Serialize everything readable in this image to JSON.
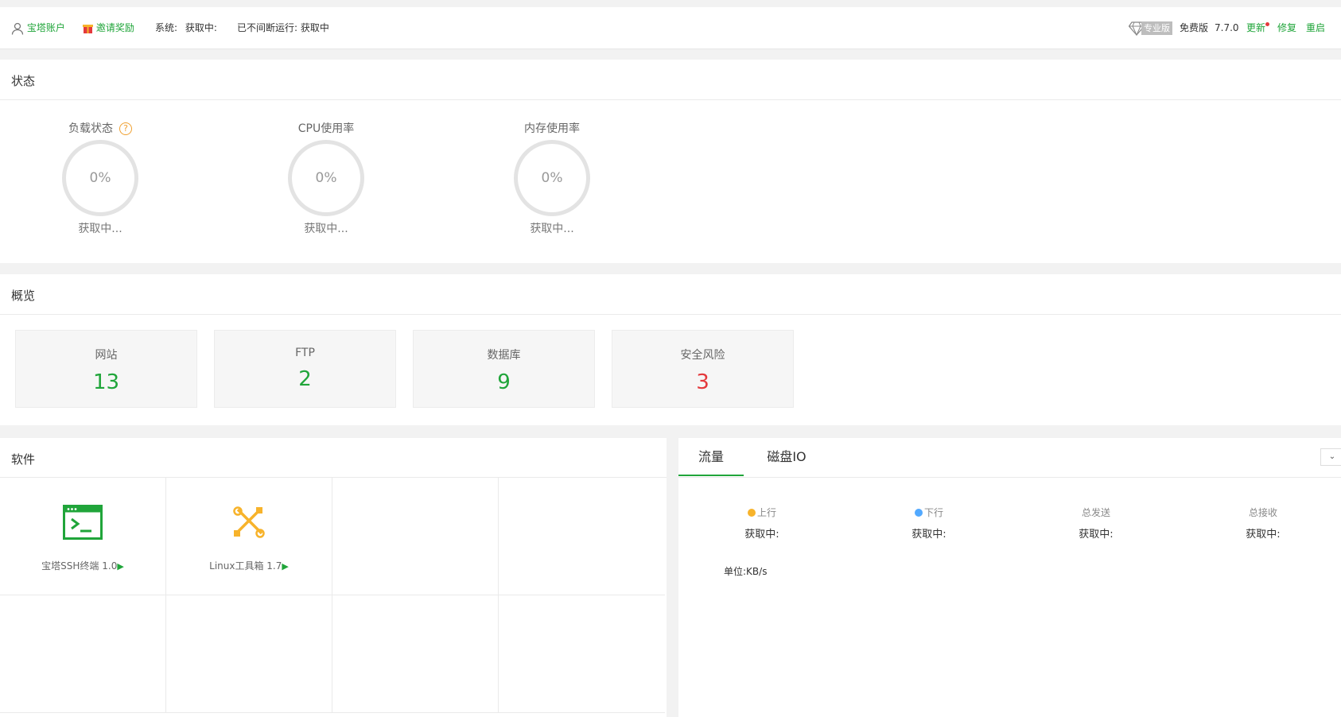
{
  "topbar": {
    "account_label": "宝塔账户",
    "invite_label": "邀请奖励",
    "system_label": "系统:",
    "system_value": "获取中:",
    "uptime_label": "已不间断运行: 获取中",
    "pro_badge": "专业版",
    "edition": "免费版",
    "version": "7.7.0",
    "update_label": "更新",
    "repair_label": "修复",
    "restart_label": "重启"
  },
  "status": {
    "title": "状态",
    "gauges": [
      {
        "label": "负载状态",
        "value": "0%",
        "sub": "获取中..."
      },
      {
        "label": "CPU使用率",
        "value": "0%",
        "sub": "获取中..."
      },
      {
        "label": "内存使用率",
        "value": "0%",
        "sub": "获取中..."
      }
    ],
    "help_glyph": "?"
  },
  "overview": {
    "title": "概览",
    "cards": [
      {
        "name": "网站",
        "value": "13",
        "color": "#20a53a"
      },
      {
        "name": "FTP",
        "value": "2",
        "color": "#20a53a"
      },
      {
        "name": "数据库",
        "value": "9",
        "color": "#20a53a"
      },
      {
        "name": "安全风险",
        "value": "3",
        "color": "#e4393c"
      }
    ]
  },
  "software": {
    "title": "软件",
    "items": [
      {
        "name": "宝塔SSH终端 1.0",
        "icon": "terminal-icon"
      },
      {
        "name": "Linux工具箱 1.7",
        "icon": "toolbox-icon"
      }
    ]
  },
  "traffic": {
    "tabs": [
      "流量",
      "磁盘IO"
    ],
    "active_tab": 0,
    "stats": [
      {
        "label": "上行",
        "value": "获取中:",
        "dot": "#f7b32b"
      },
      {
        "label": "下行",
        "value": "获取中:",
        "dot": "#52a9ff"
      },
      {
        "label": "总发送",
        "value": "获取中:"
      },
      {
        "label": "总接收",
        "value": "获取中:"
      }
    ],
    "unit_label": "单位:KB/s"
  },
  "colors": {
    "accent": "#20a53a",
    "danger": "#e4393c"
  }
}
